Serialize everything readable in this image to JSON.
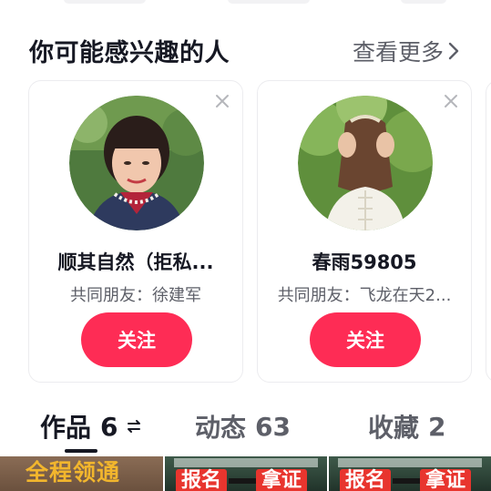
{
  "section": {
    "title": "你可能感兴趣的人",
    "see_more": "查看更多"
  },
  "cards": [
    {
      "name": "顺其自然（拒私...",
      "mutual": "共同朋友：徐建军",
      "follow_label": "关注"
    },
    {
      "name": "春雨59805",
      "mutual": "共同朋友：飞龙在天2...",
      "follow_label": "关注"
    }
  ],
  "tabs": [
    {
      "label": "作品",
      "count": "6"
    },
    {
      "label": "动态",
      "count": "63"
    },
    {
      "label": "收藏",
      "count": "2"
    }
  ],
  "thumbnails": [
    {
      "overlay_text": "全程领通"
    },
    {
      "badge_left": "报名",
      "badge_right": "拿证"
    },
    {
      "badge_left": "报名",
      "badge_right": "拿证"
    }
  ],
  "colors": {
    "accent": "#fe2c55",
    "text_primary": "#161823",
    "text_secondary": "#5d5f68",
    "card_border": "#ececef"
  },
  "icons": {
    "see_more": "chevron-right-icon",
    "dismiss": "close-icon",
    "sort": "swap-icon"
  }
}
